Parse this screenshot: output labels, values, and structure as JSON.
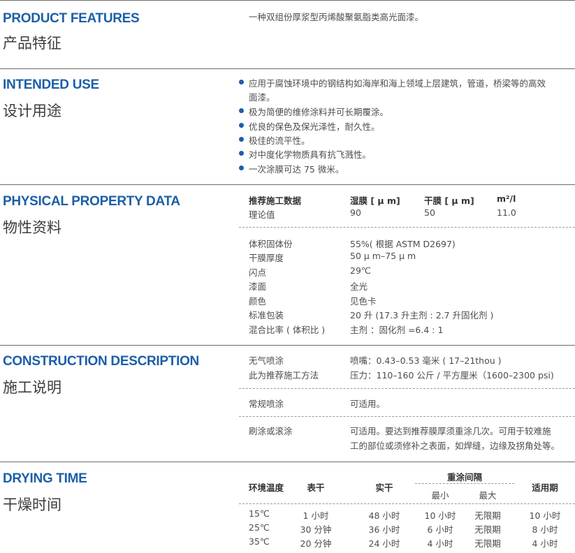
{
  "sections": {
    "features": {
      "en": "PRODUCT FEATURES",
      "zh": "产品特征",
      "text": "一种双组份厚浆型丙烯酸聚氨脂类高光面漆。"
    },
    "use": {
      "en": "INTENDED USE",
      "zh": "设计用途",
      "items": [
        "应用于腐蚀环境中的钢结构如海岸和海上领域上层建筑，管道，桥梁等的高效",
        "面漆。",
        "极为简便的维修涂料并可长期覆涂。",
        "优良的保色及保光泽性，耐久性。",
        "极佳的流平性。",
        "对中度化学物质具有抗飞溅性。",
        "一次涂膜可达 75 微米。"
      ]
    },
    "physical": {
      "en": "PHYSICAL PROPERTY DATA",
      "zh": "物性资料",
      "head": [
        "推荐施工数据",
        "湿膜 [ μ m]",
        "干膜 [ μ m]",
        "m²/l"
      ],
      "theory": [
        "理论值",
        "90",
        "50",
        "11.0"
      ],
      "props": [
        [
          "体积固体份",
          "55%( 根据 ASTM D2697)"
        ],
        [
          "干膜厚度",
          "50 μ m–75 μ m"
        ],
        [
          "闪点",
          "29℃"
        ],
        [
          "漆面",
          "全光"
        ],
        [
          "颜色",
          "见色卡"
        ],
        [
          "标准包装",
          "20 升 (17.3 升主剂 : 2.7 升固化剂 )"
        ],
        [
          "混合比率 ( 体积比 )",
          "主剂 ：固化剂 =6.4 : 1"
        ]
      ]
    },
    "construction": {
      "en": "CONSTRUCTION DESCRIPTION",
      "zh": "施工说明",
      "airless_label": "无气喷涂",
      "airless_nozzle": "喷嘴：0.43–0.53 毫米 ( 17–21thou )",
      "recommend_label": "此为推荐施工方法",
      "pressure": "压力：110–160 公斤 / 平方厘米（1600–2300 psi)",
      "conv_label": "常规喷涂",
      "conv_value": "可适用。",
      "brush_label": "刷涂或滚涂",
      "brush_line1": "可适用。要达到推荐膜厚须重涂几次。可用于较难施",
      "brush_line2": "工的部位或须修补之表面，如焊缝，边缘及拐角处等。"
    },
    "drying": {
      "en": "DRYING TIME",
      "zh": "干燥时间",
      "head": {
        "temp": "环境温度",
        "surface": "表干",
        "hard": "实干",
        "recoat": "重涂间隔",
        "min": "最小",
        "max": "最大",
        "pot": "适用期"
      },
      "rows": [
        [
          "15℃",
          "1 小时",
          "48 小时",
          "10 小时",
          "无限期",
          "10 小时"
        ],
        [
          "25℃",
          "30 分钟",
          "36 小时",
          "6 小时",
          "无限期",
          "8 小时"
        ],
        [
          "35℃",
          "20 分钟",
          "24 小时",
          "4 小时",
          "无限期",
          "4 小时"
        ]
      ]
    }
  }
}
